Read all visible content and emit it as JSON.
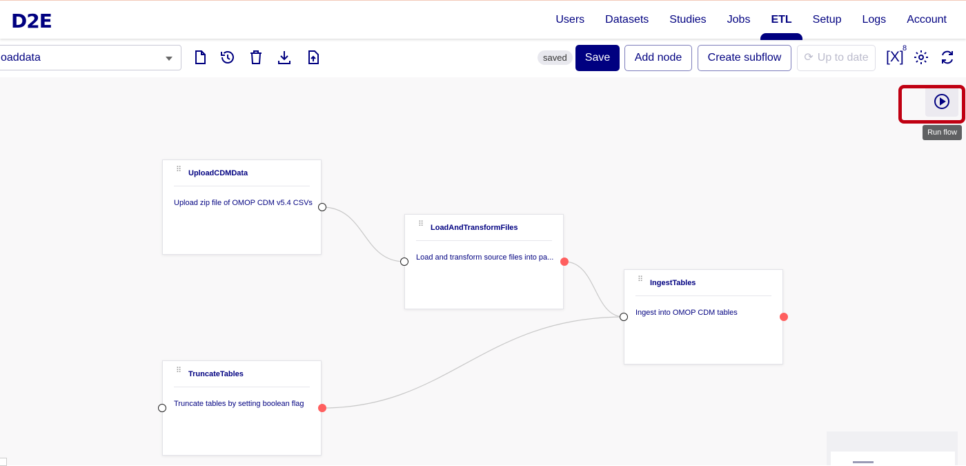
{
  "app": {
    "logo": "D2E"
  },
  "nav": {
    "items": [
      {
        "label": "Users"
      },
      {
        "label": "Datasets"
      },
      {
        "label": "Studies"
      },
      {
        "label": "Jobs"
      },
      {
        "label": "ETL",
        "active": true
      },
      {
        "label": "Setup"
      },
      {
        "label": "Logs"
      },
      {
        "label": "Account"
      }
    ]
  },
  "toolbar": {
    "flow_select_value": "oaddata",
    "icons": [
      "new-file-icon",
      "history-icon",
      "delete-icon",
      "download-icon",
      "upload-icon"
    ],
    "status": "saved",
    "save_label": "Save",
    "add_node_label": "Add node",
    "create_subflow_label": "Create subflow",
    "up_to_date_label": "Up to date",
    "variables_label": "[X]",
    "variables_count": "8"
  },
  "canvas": {
    "run_flow_tooltip": "Run flow",
    "nodes": [
      {
        "title": "UploadCDMData",
        "description": "Upload zip file of OMOP CDM v5.4 CSVs ..."
      },
      {
        "title": "LoadAndTransformFiles",
        "description": "Load and transform source files into pa..."
      },
      {
        "title": "IngestTables",
        "description": "Ingest into OMOP CDM tables"
      },
      {
        "title": "TruncateTables",
        "description": "Truncate tables by setting boolean flag"
      }
    ]
  },
  "colors": {
    "brand": "#000080",
    "output_port": "#ff5f5f",
    "highlight": "#c00012"
  }
}
